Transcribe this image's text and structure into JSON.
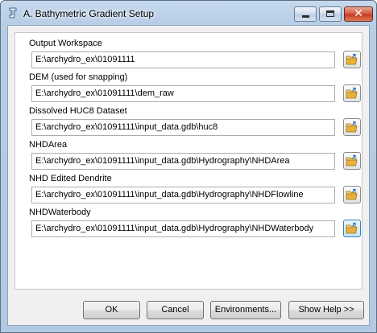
{
  "window": {
    "title": "A. Bathymetric Gradient Setup"
  },
  "fields": [
    {
      "label": "Output Workspace",
      "value": "E:\\archydro_ex\\01091111"
    },
    {
      "label": "DEM (used for snapping)",
      "value": "E:\\archydro_ex\\01091111\\dem_raw"
    },
    {
      "label": "Dissolved HUC8 Dataset",
      "value": "E:\\archydro_ex\\01091111\\input_data.gdb\\huc8"
    },
    {
      "label": "NHDArea",
      "value": "E:\\archydro_ex\\01091111\\input_data.gdb\\Hydrography\\NHDArea"
    },
    {
      "label": "NHD Edited Dendrite",
      "value": "E:\\archydro_ex\\01091111\\input_data.gdb\\Hydrography\\NHDFlowline"
    },
    {
      "label": "NHDWaterbody",
      "value": "E:\\archydro_ex\\01091111\\input_data.gdb\\Hydrography\\NHDWaterbody"
    }
  ],
  "buttons": {
    "ok": "OK",
    "cancel": "Cancel",
    "environments": "Environments...",
    "show_help": "Show Help >>"
  },
  "icons": {
    "app": "toolbox-script-icon",
    "browse": "open-folder-icon",
    "minimize": "minimize-icon",
    "maximize": "maximize-icon",
    "close": "close-icon"
  },
  "colors": {
    "title_bar": "#b6cde6",
    "close_button": "#c43a22",
    "folder": "#e8b13a"
  }
}
